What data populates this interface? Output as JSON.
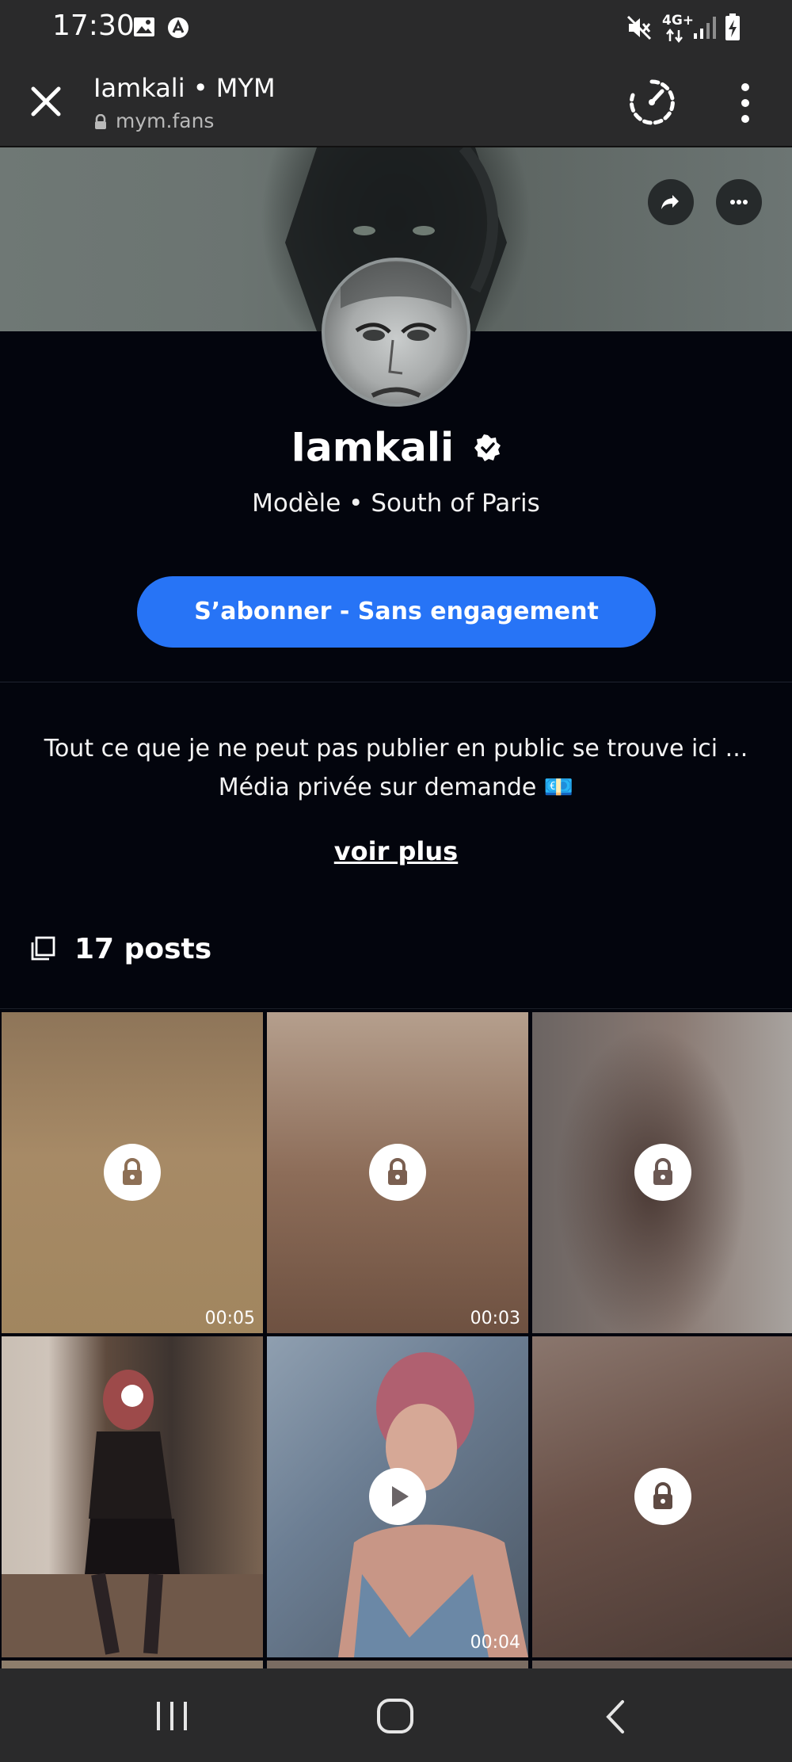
{
  "status_bar": {
    "time": "17:30",
    "network": "4G+"
  },
  "browser": {
    "title": "Iamkali • MYM",
    "url": "mym.fans"
  },
  "profile": {
    "name": "Iamkali",
    "subtitle": "Modèle • South of Paris",
    "subscribe_label": "S’abonner - Sans engagement",
    "bio_line1": "Tout ce que je ne peut pas publier en public se trouve ici ...",
    "bio_line2": "Média privée sur demande 💶",
    "see_more": "voir plus",
    "posts_count": "17 posts"
  },
  "posts": [
    {
      "type": "locked",
      "duration": "00:05",
      "color": "#a48765"
    },
    {
      "type": "locked",
      "duration": "00:03",
      "color": "#7f6453"
    },
    {
      "type": "locked",
      "duration": "",
      "color": "#6d5f58"
    },
    {
      "type": "photo",
      "duration": "",
      "color": "#6e5a4d"
    },
    {
      "type": "video",
      "duration": "00:04",
      "color": "#5b6878"
    },
    {
      "type": "locked",
      "duration": "",
      "color": "#5d4a43"
    }
  ],
  "icons": {
    "close": "close-icon",
    "speed": "speed-gauge-icon",
    "more": "more-vertical-icon",
    "share": "share-icon",
    "options": "more-horizontal-icon",
    "verified": "verified-badge-icon",
    "posts": "posts-stack-icon",
    "lock": "lock-icon",
    "play": "play-icon",
    "recents": "recent-apps-icon",
    "home": "home-icon",
    "back": "back-icon"
  },
  "colors": {
    "accent": "#2774f6",
    "background": "#03050d",
    "chrome": "#2a2a2b"
  }
}
